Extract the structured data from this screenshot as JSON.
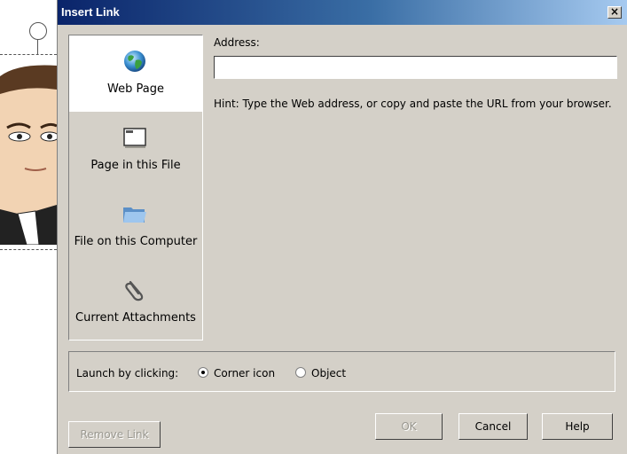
{
  "dialog": {
    "title": "Insert Link",
    "close_glyph": "×"
  },
  "link_types": [
    {
      "label": "Web Page",
      "icon": "globe-icon",
      "selected": true
    },
    {
      "label": "Page in this File",
      "icon": "page-window-icon",
      "selected": false
    },
    {
      "label": "File on this Computer",
      "icon": "folder-icon",
      "selected": false
    },
    {
      "label": "Current Attachments",
      "icon": "paperclip-icon",
      "selected": false
    }
  ],
  "address": {
    "label": "Address:",
    "value": ""
  },
  "hint": "Hint: Type the Web address, or copy and paste the URL from your browser.",
  "launch": {
    "label": "Launch by clicking:",
    "options": [
      {
        "label": "Corner icon",
        "checked": true
      },
      {
        "label": "Object",
        "checked": false
      }
    ]
  },
  "buttons": {
    "remove_link": "Remove Link",
    "ok": "OK",
    "cancel": "Cancel",
    "help": "Help"
  },
  "colors": {
    "dialog_bg": "#d4d0c8",
    "title_start": "#0a246a",
    "title_end": "#a6caf0"
  }
}
